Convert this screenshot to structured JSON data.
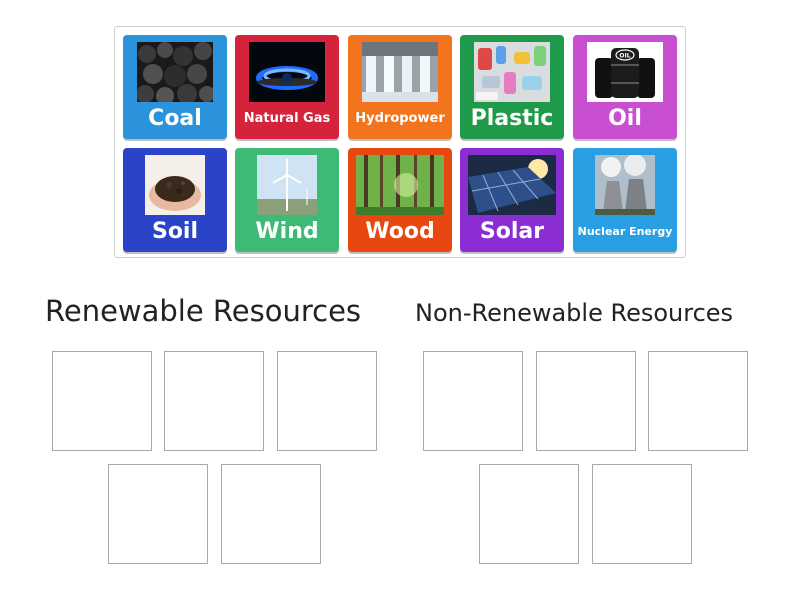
{
  "tray": {
    "tiles": [
      {
        "label": "Coal",
        "image": "coal-photo",
        "color": "#2a93dc"
      },
      {
        "label": "Natural Gas",
        "image": "gas-flame-photo",
        "color": "#d6233c"
      },
      {
        "label": "Hydropower",
        "image": "dam-photo",
        "color": "#f2741c"
      },
      {
        "label": "Plastic",
        "image": "plastic-waste-photo",
        "color": "#1f9a4a"
      },
      {
        "label": "Oil",
        "image": "oil-barrels-photo",
        "color": "#c84fd0"
      },
      {
        "label": "Soil",
        "image": "soil-hands-photo",
        "color": "#2a43c9"
      },
      {
        "label": "Wind",
        "image": "wind-turbine-photo",
        "color": "#3dbb76"
      },
      {
        "label": "Wood",
        "image": "forest-photo",
        "color": "#e8480f"
      },
      {
        "label": "Solar",
        "image": "solar-panels-photo",
        "color": "#8a2ed3"
      },
      {
        "label": "Nuclear Energy",
        "image": "cooling-towers-photo",
        "color": "#2a9ee2"
      }
    ]
  },
  "groups": {
    "renewable": {
      "title": "Renewable Resources",
      "slots": 5
    },
    "nonrenewable": {
      "title": "Non-Renewable Resources",
      "slots": 5
    }
  }
}
